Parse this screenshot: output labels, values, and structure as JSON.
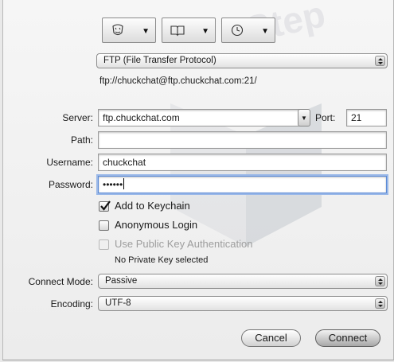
{
  "toolbar": {
    "buttons": [
      {
        "icon": "bonjour-icon"
      },
      {
        "icon": "bookmarks-icon"
      },
      {
        "icon": "history-icon"
      }
    ]
  },
  "protocol": {
    "selected": "FTP (File Transfer Protocol)"
  },
  "url_preview": "ftp://chuckchat@ftp.chuckchat.com:21/",
  "form": {
    "server_label": "Server:",
    "server_value": "ftp.chuckchat.com",
    "port_label": "Port:",
    "port_value": "21",
    "path_label": "Path:",
    "path_value": "",
    "username_label": "Username:",
    "username_value": "chuckchat",
    "password_label": "Password:",
    "password_value": "••••••"
  },
  "options": {
    "keychain": {
      "label": "Add to Keychain",
      "checked": true
    },
    "anonymous": {
      "label": "Anonymous Login",
      "checked": false
    },
    "public_key": {
      "label": "Use Public Key Authentication",
      "checked": false,
      "enabled": false
    },
    "private_key_status": "No Private Key selected"
  },
  "connect_mode": {
    "label": "Connect Mode:",
    "selected": "Passive"
  },
  "encoding": {
    "label": "Encoding:",
    "selected": "UTF-8"
  },
  "actions": {
    "cancel": "Cancel",
    "connect": "Connect"
  }
}
